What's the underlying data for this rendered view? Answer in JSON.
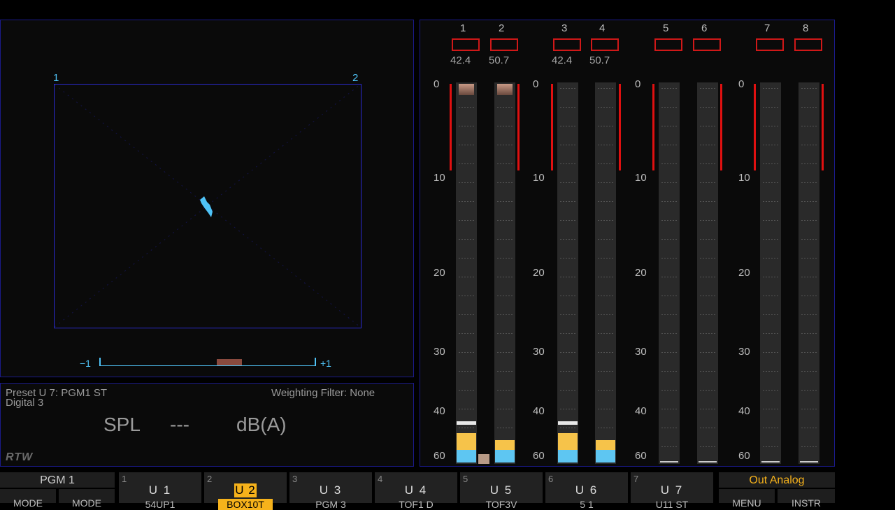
{
  "goniometer": {
    "ch_left": "1",
    "ch_right": "2",
    "corr_minus": "−1",
    "corr_plus": "+1",
    "correlation_value": 0.2
  },
  "info": {
    "preset": "Preset U 7: PGM1 ST",
    "source": "Digital 3",
    "weighting": "Weighting Filter: None",
    "spl_label": "SPL",
    "spl_value": "---",
    "spl_unit": "dB(A)",
    "logo": "RTW"
  },
  "meters": {
    "scale": [
      "0",
      "10",
      "20",
      "30",
      "40",
      "60"
    ],
    "channels": [
      {
        "num": "1",
        "peak": "42.4"
      },
      {
        "num": "2",
        "peak": "50.7"
      },
      {
        "num": "3",
        "peak": "42.4"
      },
      {
        "num": "4",
        "peak": "50.7"
      },
      {
        "num": "5",
        "peak": ""
      },
      {
        "num": "6",
        "peak": ""
      },
      {
        "num": "7",
        "peak": ""
      },
      {
        "num": "8",
        "peak": ""
      }
    ]
  },
  "bottom": {
    "pgm": "PGM 1",
    "mode1": "MODE",
    "mode2": "MODE",
    "buttons": [
      {
        "num": "1",
        "label": "U 1",
        "sub": "54UP1"
      },
      {
        "num": "2",
        "label": "U 2",
        "sub": "BOX10T"
      },
      {
        "num": "3",
        "label": "U 3",
        "sub": "PGM 3"
      },
      {
        "num": "4",
        "label": "U 4",
        "sub": "TOF1 D"
      },
      {
        "num": "5",
        "label": "U 5",
        "sub": "TOF3V"
      },
      {
        "num": "6",
        "label": "U 6",
        "sub": "5 1"
      },
      {
        "num": "7",
        "label": "U 7",
        "sub": "U11 ST"
      }
    ],
    "out": "Out Analog",
    "menu": "MENU",
    "instr": "INSTR"
  },
  "colors": {
    "accent_blue": "#4fc3f7",
    "frame_blue": "#2b2bd0",
    "peak_red": "#e01010",
    "active_yellow": "#f6b21b"
  }
}
